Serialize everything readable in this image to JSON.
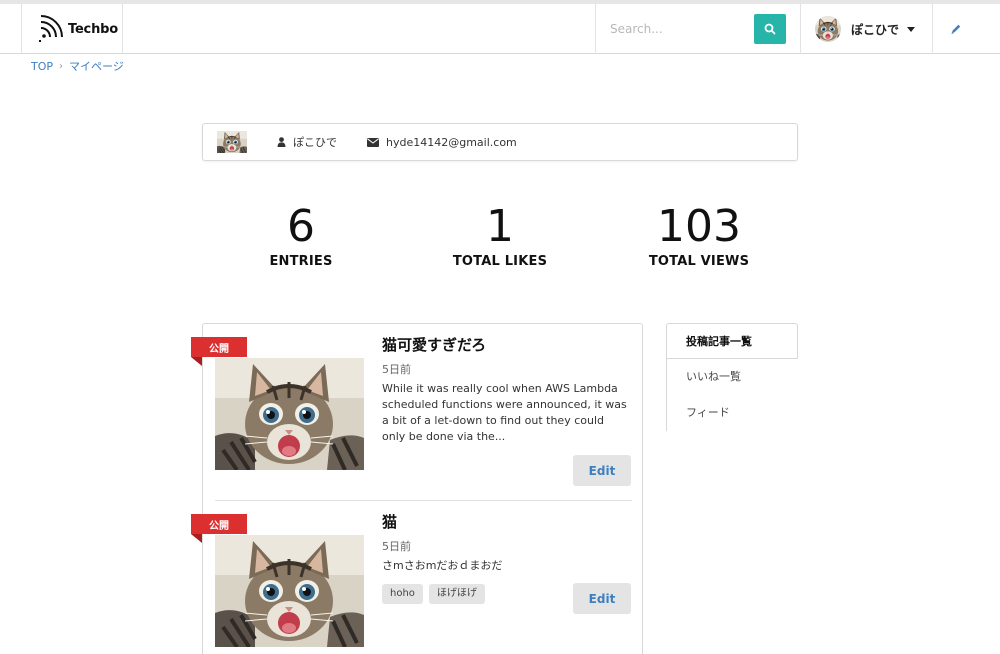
{
  "header": {
    "brand": "Techbo",
    "search_placeholder": "Search...",
    "user_name": "ぽこひで"
  },
  "breadcrumb": {
    "items": [
      "TOP",
      "マイページ"
    ]
  },
  "profile": {
    "name": "ぽこひで",
    "email": "hyde14142@gmail.com"
  },
  "stats": [
    {
      "value": "6",
      "label": "ENTRIES"
    },
    {
      "value": "1",
      "label": "TOTAL LIKES"
    },
    {
      "value": "103",
      "label": "TOTAL VIEWS"
    }
  ],
  "entries": [
    {
      "status": "公開",
      "title": "猫可愛すぎだろ",
      "date": "5日前",
      "excerpt": "While it was really cool when AWS Lambda scheduled functions were announced, it was a bit of a let-down to find out they could only be done via the...",
      "edit_label": "Edit"
    },
    {
      "status": "公開",
      "title": "猫",
      "date": "5日前",
      "excerpt": "さmさおmだおｄまおだ",
      "tags": [
        "hoho",
        "ほげほげ"
      ],
      "edit_label": "Edit"
    }
  ],
  "sidenav": {
    "items": [
      "投稿記事一覧",
      "いいね一覧",
      "フィード"
    ],
    "active_index": 0
  },
  "colors": {
    "accent": "#26b5a8",
    "link": "#3d7fc1",
    "ribbon": "#dc2f2f"
  }
}
